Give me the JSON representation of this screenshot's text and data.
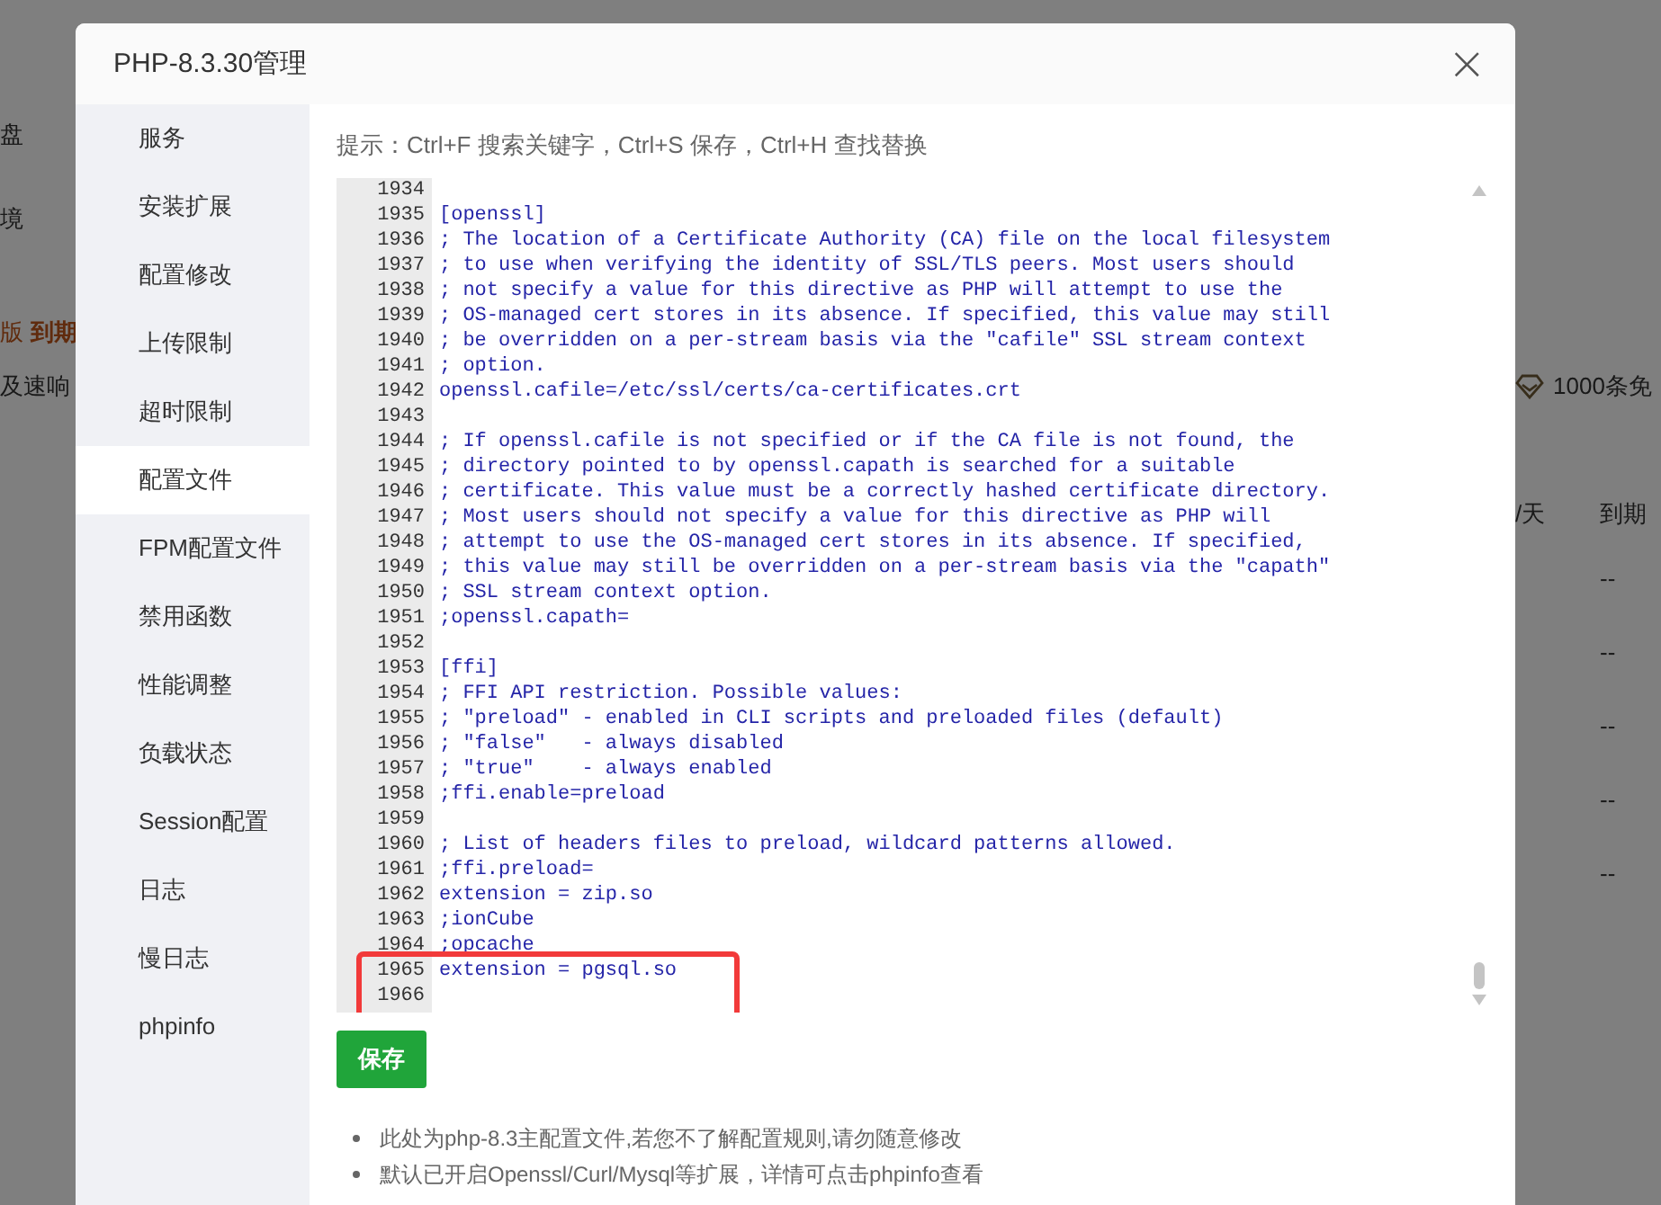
{
  "background": {
    "left_texts": [
      "盘",
      "境",
      "版",
      "到期",
      "及速响"
    ],
    "promo": "1000条免",
    "column_headers": [
      "/天",
      "到期"
    ],
    "expiry_cells": [
      "--",
      "--",
      "--",
      "--",
      "--"
    ]
  },
  "dialog": {
    "title": "PHP-8.3.30管理",
    "close": "×"
  },
  "sidebar": {
    "items": [
      {
        "label": "服务",
        "selected": false
      },
      {
        "label": "安装扩展",
        "selected": false
      },
      {
        "label": "配置修改",
        "selected": false
      },
      {
        "label": "上传限制",
        "selected": false
      },
      {
        "label": "超时限制",
        "selected": false
      },
      {
        "label": "配置文件",
        "selected": true
      },
      {
        "label": "FPM配置文件",
        "selected": false
      },
      {
        "label": "禁用函数",
        "selected": false
      },
      {
        "label": "性能调整",
        "selected": false
      },
      {
        "label": "负载状态",
        "selected": false
      },
      {
        "label": "Session配置",
        "selected": false
      },
      {
        "label": "日志",
        "selected": false
      },
      {
        "label": "慢日志",
        "selected": false
      },
      {
        "label": "phpinfo",
        "selected": false
      }
    ]
  },
  "hint": "提示：Ctrl+F 搜索关键字，Ctrl+S 保存，Ctrl+H 查找替换",
  "editor": {
    "lines": [
      {
        "number": "1934"
      },
      {
        "number": "1935",
        "text": "[openssl]"
      },
      {
        "number": "1936",
        "text": "; The location of a Certificate Authority (CA) file on the local filesystem"
      },
      {
        "number": "1937",
        "text": "; to use when verifying the identity of SSL/TLS peers. Most users should"
      },
      {
        "number": "1938",
        "text": "; not specify a value for this directive as PHP will attempt to use the"
      },
      {
        "number": "1939",
        "text": "; OS-managed cert stores in its absence. If specified, this value may still"
      },
      {
        "number": "1940",
        "text": "; be overridden on a per-stream basis via the \"cafile\" SSL stream context"
      },
      {
        "number": "1941",
        "text": "; option."
      },
      {
        "number": "1942",
        "text": "openssl.cafile=/etc/ssl/certs/ca-certificates.crt"
      },
      {
        "number": "1943"
      },
      {
        "number": "1944",
        "text": "; If openssl.cafile is not specified or if the CA file is not found, the"
      },
      {
        "number": "1945",
        "text": "; directory pointed to by openssl.capath is searched for a suitable"
      },
      {
        "number": "1946",
        "text": "; certificate. This value must be a correctly hashed certificate directory."
      },
      {
        "number": "1947",
        "text": "; Most users should not specify a value for this directive as PHP will"
      },
      {
        "number": "1948",
        "text": "; attempt to use the OS-managed cert stores in its absence. If specified,"
      },
      {
        "number": "1949",
        "text": "; this value may still be overridden on a per-stream basis via the \"capath\""
      },
      {
        "number": "1950",
        "text": "; SSL stream context option."
      },
      {
        "number": "1951",
        "text": ";openssl.capath="
      },
      {
        "number": "1952"
      },
      {
        "number": "1953",
        "text": "[ffi]"
      },
      {
        "number": "1954",
        "text": "; FFI API restriction. Possible values:"
      },
      {
        "number": "1955",
        "text": "; \"preload\" - enabled in CLI scripts and preloaded files (default)"
      },
      {
        "number": "1956",
        "text": "; \"false\"   - always disabled"
      },
      {
        "number": "1957",
        "text": "; \"true\"    - always enabled"
      },
      {
        "number": "1958",
        "text": ";ffi.enable=preload"
      },
      {
        "number": "1959"
      },
      {
        "number": "1960",
        "text": "; List of headers files to preload, wildcard patterns allowed."
      },
      {
        "number": "1961",
        "text": ";ffi.preload="
      },
      {
        "number": "1962",
        "text": "extension = zip.so"
      },
      {
        "number": "1963",
        "text": ";ionCube"
      },
      {
        "number": "1964",
        "text": ";opcache"
      },
      {
        "number": "1965",
        "text": "extension = pgsql.so",
        "highlighted": true
      },
      {
        "number": "1966",
        "highlighted": true
      }
    ]
  },
  "save_button": "保存",
  "notes": [
    "此处为php-8.3主配置文件,若您不了解配置规则,请勿随意修改",
    "默认已开启Openssl/Curl/Mysql等扩展，详情可点击phpinfo查看"
  ]
}
